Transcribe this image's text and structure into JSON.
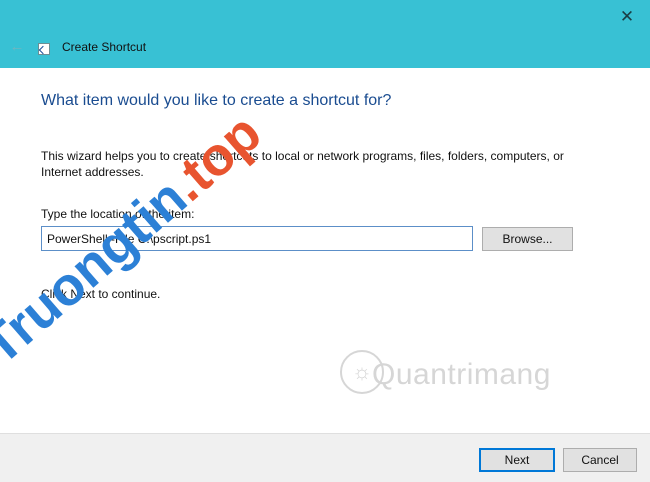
{
  "window": {
    "title": "Create Shortcut",
    "close_glyph": "✕",
    "back_glyph": "←",
    "header_color": "#38c1d4"
  },
  "main": {
    "heading": "What item would you like to create a shortcut for?",
    "description": "This wizard helps you to create shortcuts to local or network programs, files, folders, computers, or Internet addresses.",
    "location_label": "Type the location of the item:",
    "location_value": "PowerShell -File C:\\pscript.ps1",
    "browse_label": "Browse...",
    "hint": "Click Next to continue."
  },
  "watermarks": {
    "logo_text": "Quantrimang",
    "diagonal_a": "Truongtin",
    "diagonal_b": ".top"
  },
  "footer": {
    "next_label": "Next",
    "cancel_label": "Cancel"
  }
}
